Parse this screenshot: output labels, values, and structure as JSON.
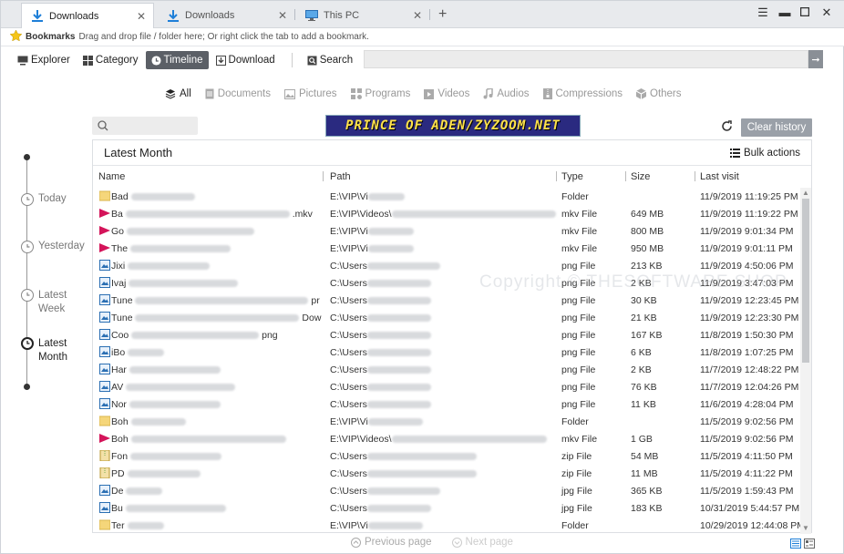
{
  "tabs": [
    {
      "label": "Downloads",
      "icon": "download-icon",
      "active": true
    },
    {
      "label": "Downloads",
      "icon": "download-icon",
      "active": false
    },
    {
      "label": "This PC",
      "icon": "computer-icon",
      "active": false
    }
  ],
  "bookmarks": {
    "label": "Bookmarks",
    "hint": "Drag and drop file / folder here; Or right click the tab to add a bookmark."
  },
  "toolbar": {
    "explorer": "Explorer",
    "category": "Category",
    "timeline": "Timeline",
    "download": "Download",
    "search": "Search"
  },
  "filters": [
    "All",
    "Documents",
    "Pictures",
    "Programs",
    "Videos",
    "Audios",
    "Compressions",
    "Others"
  ],
  "banner": "PRINCE OF ADEN/ZYZOOM.NET",
  "clear_history": "Clear history",
  "timeline_nodes": [
    "Today",
    "Yesterday",
    "Latest Week",
    "Latest Month"
  ],
  "panel": {
    "title": "Latest Month",
    "bulk": "Bulk actions"
  },
  "columns": {
    "name": "Name",
    "path": "Path",
    "type": "Type",
    "size": "Size",
    "visit": "Last visit"
  },
  "rows": [
    {
      "icon": "folder",
      "name": "Bad",
      "path": "E:\\VIP\\Vi",
      "type": "Folder",
      "size": "",
      "visit": "11/9/2019 11:19:25 PM"
    },
    {
      "icon": "video",
      "name": "Ba",
      "nameTail": ".mkv",
      "path": "E:\\VIP\\Videos\\",
      "type": "mkv File",
      "size": "649 MB",
      "visit": "11/9/2019 11:19:22 PM"
    },
    {
      "icon": "video",
      "name": "Go",
      "path": "E:\\VIP\\Vi",
      "type": "mkv File",
      "size": "800 MB",
      "visit": "11/9/2019 9:01:34 PM"
    },
    {
      "icon": "video",
      "name": "The",
      "path": "E:\\VIP\\Vi",
      "type": "mkv File",
      "size": "950 MB",
      "visit": "11/9/2019 9:01:11 PM"
    },
    {
      "icon": "image",
      "name": "Jixi",
      "path": "C:\\Users",
      "type": "png File",
      "size": "213 KB",
      "visit": "11/9/2019 4:50:06 PM"
    },
    {
      "icon": "image",
      "name": "Ivaj",
      "path": "C:\\Users",
      "type": "png File",
      "size": "2 KB",
      "visit": "11/9/2019 3:47:03 PM"
    },
    {
      "icon": "image",
      "name": "Tune",
      "nameTail": "pr",
      "path": "C:\\Users",
      "type": "png File",
      "size": "30 KB",
      "visit": "11/9/2019 12:23:45 PM"
    },
    {
      "icon": "image",
      "name": "Tune",
      "nameTail": "Dow",
      "path": "C:\\Users",
      "type": "png File",
      "size": "21 KB",
      "visit": "11/9/2019 12:23:30 PM"
    },
    {
      "icon": "image",
      "name": "Coo",
      "nameTail": "png",
      "path": "C:\\Users",
      "type": "png File",
      "size": "167 KB",
      "visit": "11/8/2019 1:50:30 PM"
    },
    {
      "icon": "image",
      "name": "iBo",
      "path": "C:\\Users",
      "type": "png File",
      "size": "6 KB",
      "visit": "11/8/2019 1:07:25 PM"
    },
    {
      "icon": "image",
      "name": "Har",
      "path": "C:\\Users",
      "type": "png File",
      "size": "2 KB",
      "visit": "11/7/2019 12:48:22 PM"
    },
    {
      "icon": "image",
      "name": "AV",
      "path": "C:\\Users",
      "type": "png File",
      "size": "76 KB",
      "visit": "11/7/2019 12:04:26 PM"
    },
    {
      "icon": "image",
      "name": "Nor",
      "path": "C:\\Users",
      "type": "png File",
      "size": "11 KB",
      "visit": "11/6/2019 4:28:04 PM"
    },
    {
      "icon": "folder",
      "name": "Boh",
      "path": "E:\\VIP\\Vi",
      "type": "Folder",
      "size": "",
      "visit": "11/5/2019 9:02:56 PM"
    },
    {
      "icon": "video",
      "name": "Boh",
      "path": "E:\\VIP\\Videos\\",
      "type": "mkv File",
      "size": "1 GB",
      "visit": "11/5/2019 9:02:56 PM"
    },
    {
      "icon": "zip",
      "name": "Fon",
      "path": "C:\\Users",
      "type": "zip File",
      "size": "54 MB",
      "visit": "11/5/2019 4:11:50 PM"
    },
    {
      "icon": "zip",
      "name": "PD",
      "path": "C:\\Users",
      "type": "zip File",
      "size": "11 MB",
      "visit": "11/5/2019 4:11:22 PM"
    },
    {
      "icon": "image",
      "name": "De",
      "path": "C:\\Users",
      "type": "jpg File",
      "size": "365 KB",
      "visit": "11/5/2019 1:59:43 PM"
    },
    {
      "icon": "image",
      "name": "Bu",
      "path": "C:\\Users",
      "type": "jpg File",
      "size": "183 KB",
      "visit": "10/31/2019 5:44:57 PM"
    },
    {
      "icon": "folder",
      "name": "Ter",
      "path": "E:\\VIP\\Vi",
      "type": "Folder",
      "size": "",
      "visit": "10/29/2019 12:44:08 PM"
    }
  ],
  "pager": {
    "prev": "Previous page",
    "next": "Next page"
  },
  "watermark": "Copyright © THESOFTWARE.SHOP",
  "colors": {
    "accent": "#1e7fd8",
    "selected": "#5b5f66",
    "video": "#d4145a",
    "folder": "#f5d67a"
  }
}
